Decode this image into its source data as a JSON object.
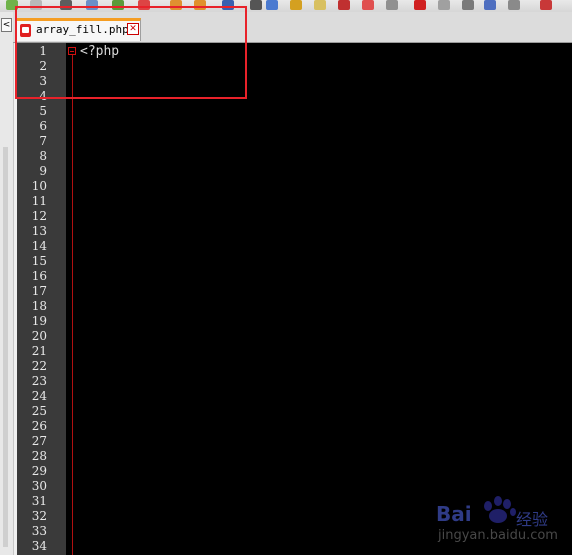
{
  "toolbar": {
    "icons": [
      "back-icon",
      "new-file-icon",
      "open-icon",
      "save-icon",
      "cut-icon",
      "copy-icon",
      "paste-icon",
      "undo-icon",
      "redo-icon",
      "find-icon",
      "zoom-icon",
      "wrap-icon",
      "indent-icon",
      "macro-record-icon",
      "macro-stop-icon",
      "macro-play-icon",
      "run-icon",
      "spell-icon"
    ]
  },
  "left_panel": {
    "collapse_glyph": "<"
  },
  "tab": {
    "filename": "array_fill.php",
    "close_glyph": "✕"
  },
  "editor": {
    "line_numbers": [
      "1",
      "2",
      "3",
      "4",
      "5",
      "6",
      "7",
      "8",
      "9",
      "10",
      "11",
      "12",
      "13",
      "14",
      "15",
      "16",
      "17",
      "18",
      "19",
      "20",
      "21",
      "22",
      "23",
      "24",
      "25",
      "26",
      "27",
      "28",
      "29",
      "30",
      "31",
      "32",
      "33",
      "34"
    ],
    "code_line_1": "<?php"
  },
  "watermark": {
    "brand": "Bai",
    "brand_suffix": "经验",
    "url": "jingyan.baidu.com"
  }
}
